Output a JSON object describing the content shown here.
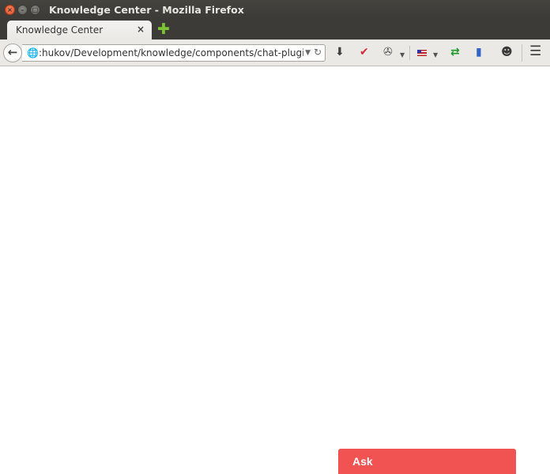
{
  "window": {
    "title": "Knowledge Center - Mozilla Firefox",
    "controls": {
      "close": "×",
      "minimize": "–",
      "maximize": "□"
    }
  },
  "tabs": [
    {
      "label": "Knowledge Center",
      "close": "×"
    }
  ],
  "new_tab": "✚",
  "navbar": {
    "back": "←",
    "url": ":hukov/Development/knowledge/components/chat-plugin",
    "url_dropdown": "▼",
    "reload": "↻",
    "toolbar_icons": [
      "download-icon",
      "pocket-icon",
      "spy-icon",
      "flag-icon",
      "arrows-icon",
      "books-icon",
      "chat-icon",
      "menu-icon"
    ]
  },
  "icons": {
    "globe": "🌐",
    "download": "⬇",
    "pocket": "✔",
    "spy": "✇",
    "drop": "▼",
    "books": "▮",
    "chat": "☻",
    "menu": "☰",
    "arrow_left": "⇆"
  },
  "chat_widget": {
    "label": "Ask",
    "color": "#f15352"
  }
}
